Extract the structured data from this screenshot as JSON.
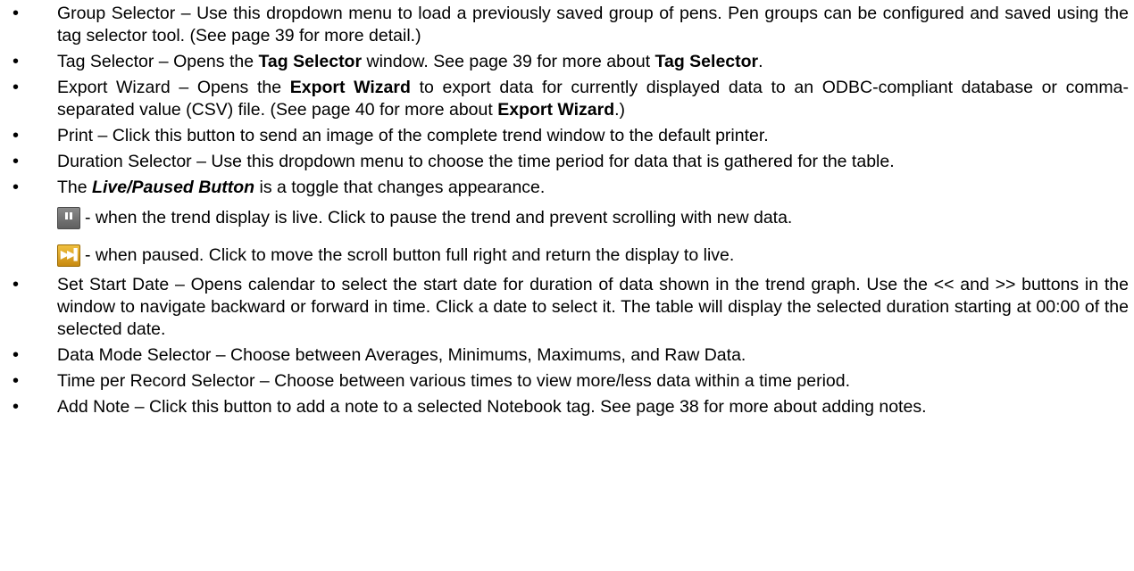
{
  "items": [
    {
      "text": "Group Selector – Use this dropdown menu to load a previously saved group of pens. Pen groups can be configured and saved using the tag selector tool. (See page 39 for more detail.)"
    },
    {
      "pre": "Tag Selector – Opens the ",
      "b1": "Tag Selector",
      "mid": " window. See page 39 for more about ",
      "b2": "Tag Selector",
      "post": "."
    },
    {
      "pre": "Export Wizard – Opens the ",
      "b1": "Export Wizard",
      "mid": " to export data for currently displayed data to an ODBC-compliant database or comma-separated value (CSV) file. (See page 40 for more about ",
      "b2": "Export Wizard",
      "post": ".)"
    },
    {
      "text": "Print – Click this button to send an image of the complete trend window to the default printer."
    },
    {
      "text": "Duration Selector – Use this dropdown menu to choose the time period for data that is gathered for the table."
    },
    {
      "pre": "The ",
      "bi": "Live/Paused Button",
      "post": " is a toggle that changes appearance."
    },
    {
      "text": "Set Start Date – Opens calendar to select the start date for duration of data shown in the trend graph. Use the << and >> buttons in the window to navigate backward or forward in time. Click a date to select it. The table will display the selected duration starting at 00:00 of the selected date."
    },
    {
      "text": "Data Mode Selector – Choose between Averages, Minimums, Maximums, and Raw Data."
    },
    {
      "text": "Time per Record Selector – Choose between various times to view more/less data within a time period."
    },
    {
      "text": "Add Note – Click this button to add a note to a selected Notebook tag. See page 38 for more about adding notes."
    }
  ],
  "bullet": "•",
  "live_states": [
    {
      "icon": "pause-icon",
      "text": " - when the trend display is live.  Click to pause the trend and prevent scrolling with new data."
    },
    {
      "icon": "play-icon",
      "glyph": "▶▶▌",
      "text": " - when paused.  Click to move the scroll button full right and return the display to live."
    }
  ]
}
